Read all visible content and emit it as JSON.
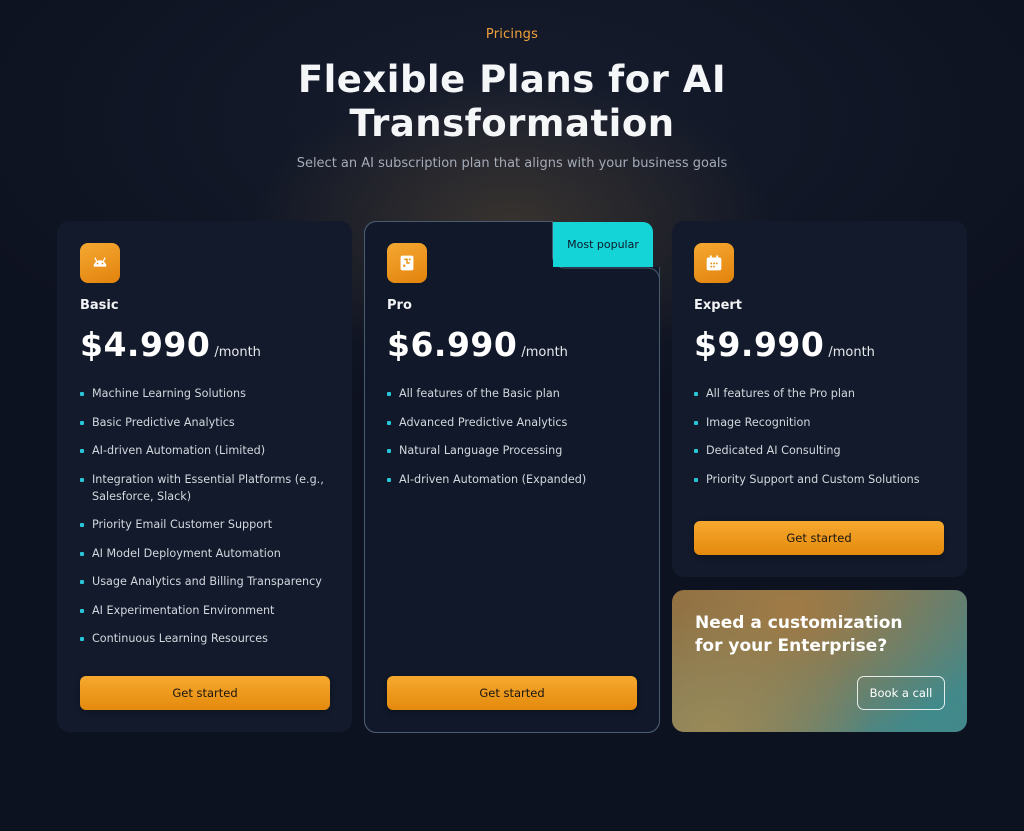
{
  "header": {
    "eyebrow": "Pricings",
    "title_line1": "Flexible Plans for AI",
    "title_line2": "Transformation",
    "subtitle": "Select an AI subscription plan that aligns with your business goals"
  },
  "plans": [
    {
      "name": "Basic",
      "price": "$4.990",
      "period": "/month",
      "icon": "android-icon",
      "features": [
        "Machine Learning Solutions",
        "Basic Predictive Analytics",
        "AI-driven Automation (Limited)",
        "Integration with Essential Platforms (e.g., Salesforce, Slack)",
        "Priority Email Customer Support",
        "AI Model Deployment Automation",
        "Usage Analytics and Billing Transparency",
        "AI Experimentation Environment",
        "Continuous Learning Resources"
      ],
      "cta": "Get started"
    },
    {
      "name": "Pro",
      "price": "$6.990",
      "period": "/month",
      "icon": "chip-icon",
      "badge": "Most popular",
      "features": [
        "All features of the Basic plan",
        "Advanced Predictive Analytics",
        "Natural Language Processing",
        "AI-driven Automation (Expanded)"
      ],
      "cta": "Get started"
    },
    {
      "name": "Expert",
      "price": "$9.990",
      "period": "/month",
      "icon": "calendar-icon",
      "features": [
        "All features of the Pro plan",
        "Image Recognition",
        "Dedicated AI Consulting",
        "Priority Support and Custom Solutions"
      ],
      "cta": "Get started"
    }
  ],
  "enterprise": {
    "title_line1": "Need a customization",
    "title_line2": "for your Enterprise?",
    "cta": "Book a call"
  },
  "colors": {
    "accent": "#f0a23a",
    "badge": "#15d4d8",
    "background": "#0d1220",
    "card": "#121a2b"
  }
}
